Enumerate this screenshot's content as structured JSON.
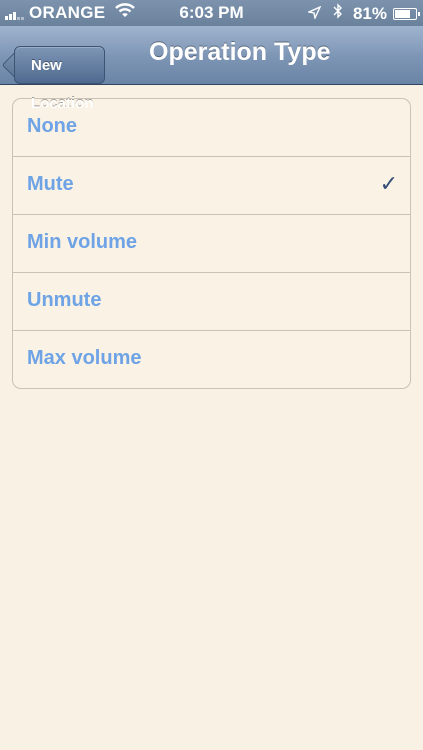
{
  "status_bar": {
    "carrier": "ORANGE",
    "time": "6:03 PM",
    "battery_percent": "81%",
    "battery_level": 0.81,
    "icons": [
      "signal-icon",
      "wifi-icon",
      "location-arrow-icon",
      "bluetooth-icon",
      "battery-icon"
    ]
  },
  "nav_bar": {
    "back_label": "New Location",
    "title": "Operation Type"
  },
  "list": {
    "items": [
      {
        "label": "None",
        "selected": false
      },
      {
        "label": "Mute",
        "selected": true
      },
      {
        "label": "Min volume",
        "selected": false
      },
      {
        "label": "Unmute",
        "selected": false
      },
      {
        "label": "Max volume",
        "selected": false
      }
    ],
    "checkmark": "✓"
  },
  "colors": {
    "background": "#f8f1e4",
    "item_text": "#6ea3e6",
    "checkmark": "#344e76",
    "nav_bar": "#7f97b6"
  }
}
